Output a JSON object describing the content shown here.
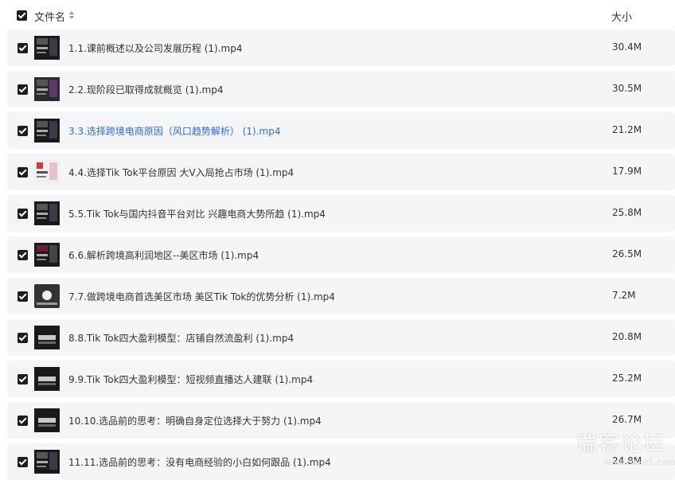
{
  "header": {
    "select_all_checked": true,
    "name_label": "文件名",
    "size_label": "大小"
  },
  "rows": [
    {
      "name": "1.1.课前概述以及公司发展历程 (1).mp4",
      "size": "30.4M",
      "checked": true
    },
    {
      "name": "2.2.现阶段已取得成就概览 (1).mp4",
      "size": "30.5M",
      "checked": true
    },
    {
      "name": "3.3.选择跨境电商原因（风口趋势解析） (1).mp4",
      "size": "21.2M",
      "checked": true
    },
    {
      "name": "4.4.选择Tik Tok平台原因 大V入局抢占市场 (1).mp4",
      "size": "17.9M",
      "checked": true
    },
    {
      "name": "5.5.Tik Tok与国内抖音平台对比 兴趣电商大势所趋 (1).mp4",
      "size": "25.8M",
      "checked": true
    },
    {
      "name": "6.6.解析跨境高利润地区--美区市场 (1).mp4",
      "size": "26.5M",
      "checked": true
    },
    {
      "name": "7.7.做跨境电商首选美区市场 美区Tik Tok的优势分析 (1).mp4",
      "size": "7.2M",
      "checked": true
    },
    {
      "name": "8.8.Tik Tok四大盈利模型：店铺自然流盈利 (1).mp4",
      "size": "20.8M",
      "checked": true
    },
    {
      "name": "9.9.Tik Tok四大盈利模型：短视频直播达人建联 (1).mp4",
      "size": "25.2M",
      "checked": true
    },
    {
      "name": "10.10.选品前的思考：明确自身定位选择大于努力 (1).mp4",
      "size": "26.7M",
      "checked": true
    },
    {
      "name": "11.11.选品前的思考：没有电商经验的小白如何跟品 (1).mp4",
      "size": "24.8M",
      "checked": true
    }
  ],
  "watermark": {
    "text": "瑞客论坛",
    "sub": "www.ruike1.com"
  },
  "colors": {
    "row_bg": "#f4f5f7",
    "checkbox": "#1d1d1d",
    "link": "#2e6bd6",
    "text": "#333333"
  }
}
